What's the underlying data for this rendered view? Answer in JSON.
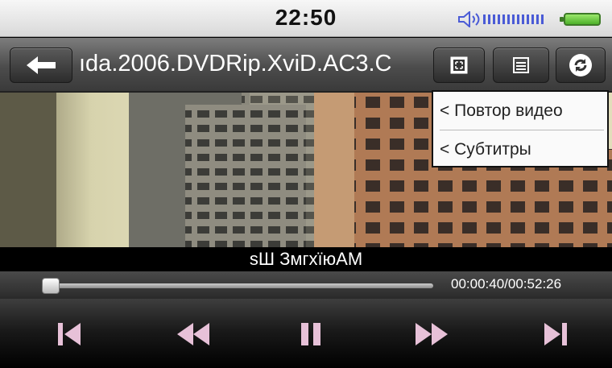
{
  "status_bar": {
    "time": "22:50",
    "volume_icon": "speaker-icon",
    "battery_icon": "battery-icon"
  },
  "title_bar": {
    "back_icon": "back-arrow-icon",
    "title": "ıda.2006.DVDRip.XviD.AC3.C",
    "buttons": [
      "aspect-ratio-icon",
      "menu-icon",
      "refresh-icon"
    ]
  },
  "menu": {
    "items": [
      {
        "label": "< Повтор видео"
      },
      {
        "label": "< Субтитры"
      }
    ]
  },
  "subtitle": {
    "text": "sШ ЗмгхїюАМ"
  },
  "playback": {
    "time": "00:00:40/00:52:26",
    "progress": 0.013
  },
  "controls": [
    "previous-icon",
    "rewind-icon",
    "pause-icon",
    "fast-forward-icon",
    "next-icon"
  ],
  "colors": {
    "accent_pink": "#e7c1d8",
    "battery_green": "#4db12a",
    "volume_blue": "#4a5bd6"
  }
}
